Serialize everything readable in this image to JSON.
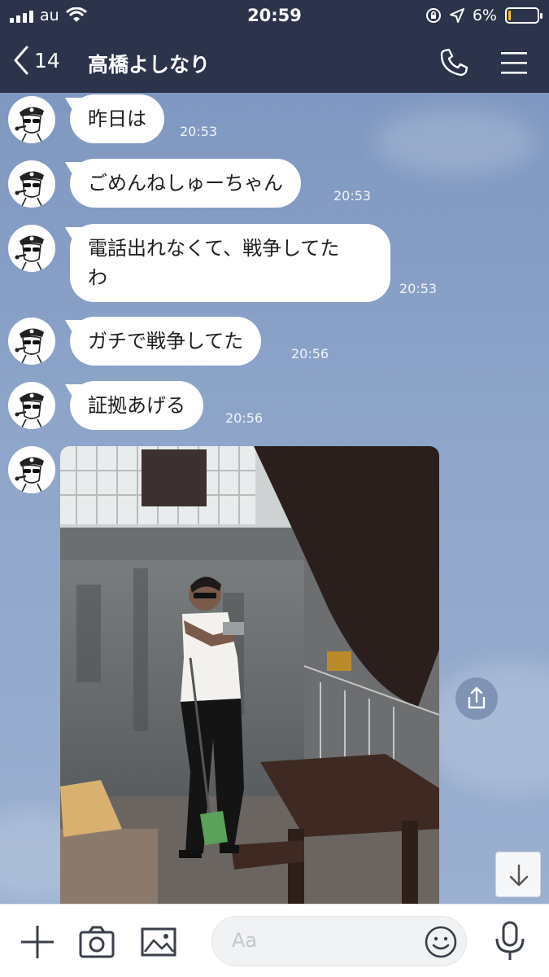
{
  "status_bar": {
    "carrier": "au",
    "time": "20:59",
    "battery_percent_label": "6%",
    "battery_level": 0.06
  },
  "header": {
    "back_count": "14",
    "title": "高橋よしなり"
  },
  "messages": [
    {
      "text": "昨日は",
      "time": "20:53"
    },
    {
      "text": "ごめんねしゅーちゃん",
      "time": "20:53"
    },
    {
      "text_line1": "電話出れなくて、戦争してた",
      "text_line2": "わ",
      "time": "20:53"
    },
    {
      "text": "ガチで戦争してた",
      "time": "20:56"
    },
    {
      "text": "証拠あげる",
      "time": "20:56"
    }
  ],
  "input": {
    "placeholder": "Aa"
  },
  "colors": {
    "header_bg": "#2b344a",
    "chat_bg": "#8da3c8",
    "battery_low": "#f7c600"
  }
}
